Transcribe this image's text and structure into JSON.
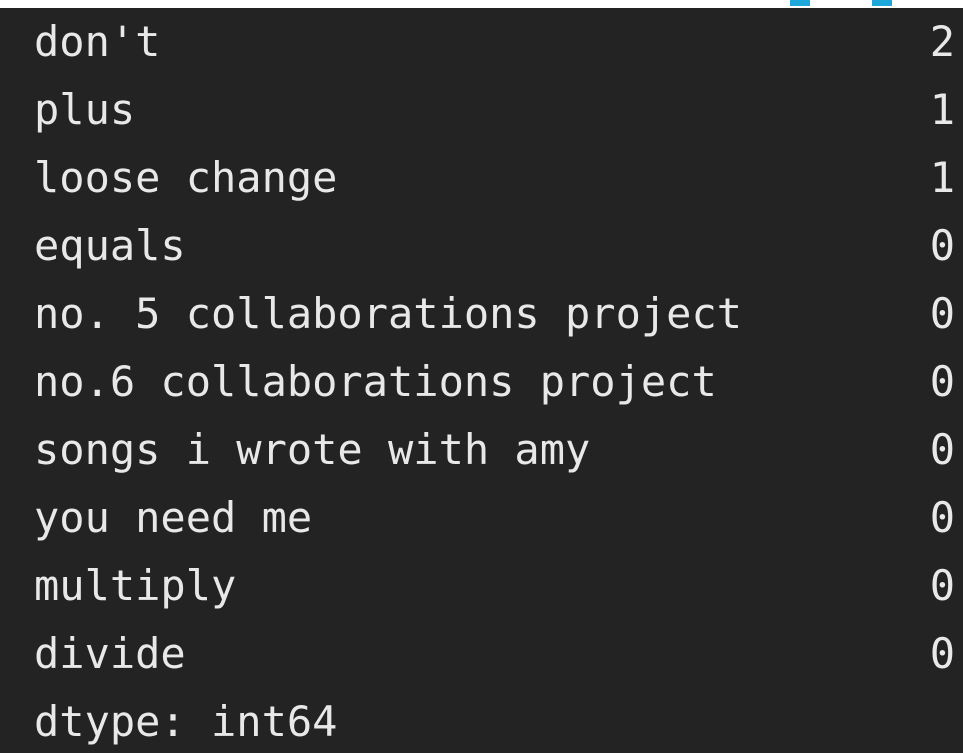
{
  "output": {
    "rows": [
      {
        "label": "don't",
        "count": "2"
      },
      {
        "label": "plus",
        "count": "1"
      },
      {
        "label": "loose change",
        "count": "1"
      },
      {
        "label": "equals",
        "count": "0"
      },
      {
        "label": "no. 5 collaborations project",
        "count": "0"
      },
      {
        "label": "no.6 collaborations project",
        "count": "0"
      },
      {
        "label": "songs i wrote with amy",
        "count": "0"
      },
      {
        "label": "you need me",
        "count": "0"
      },
      {
        "label": "multiply",
        "count": "0"
      },
      {
        "label": "divide",
        "count": "0"
      }
    ],
    "dtype": "dtype: int64"
  },
  "colors": {
    "background": "#232323",
    "text": "#e8e8e8",
    "accent": "#1ea7d9"
  }
}
